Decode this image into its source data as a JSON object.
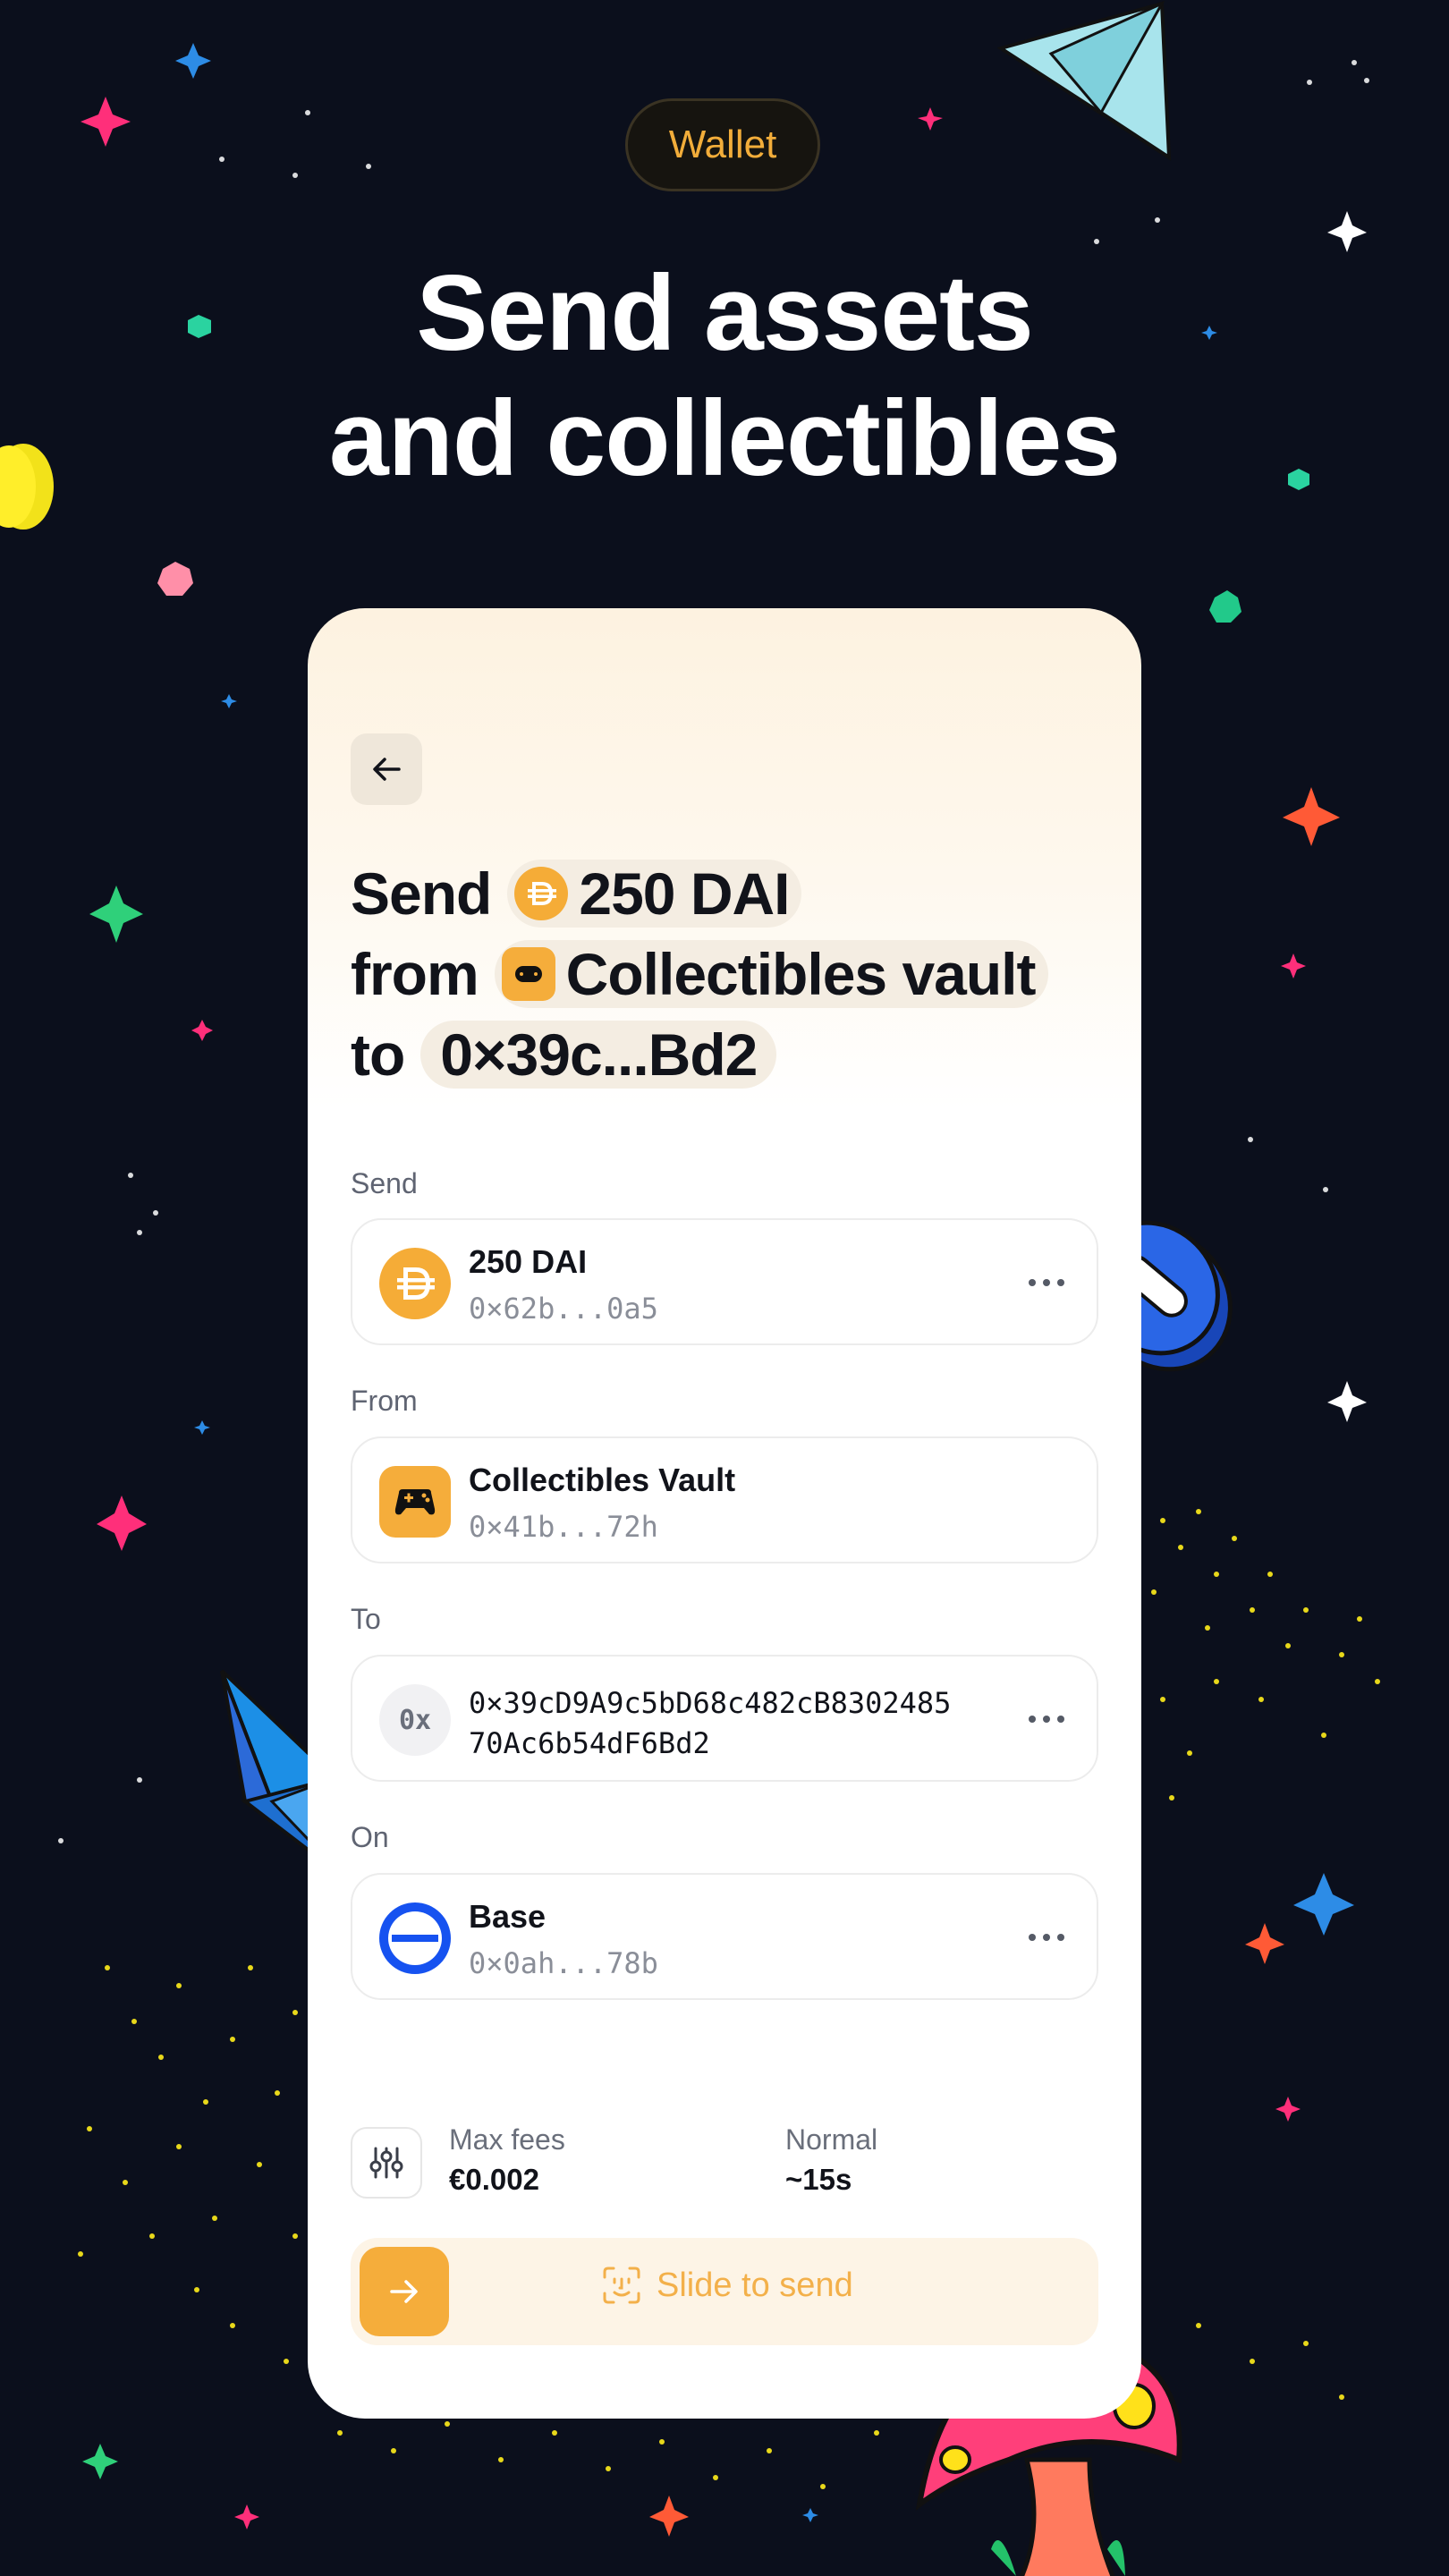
{
  "pill_label": "Wallet",
  "headline": {
    "line1": "Send assets",
    "line2": "and collectibles"
  },
  "summary": {
    "send_word": "Send",
    "amount": "250 DAI",
    "from_word": "from",
    "vault": "Collectibles vault",
    "to_word": "to",
    "address_short": "0×39c...Bd2"
  },
  "sections": {
    "send": {
      "label": "Send",
      "title": "250 DAI",
      "sub": "0×62b...0a5"
    },
    "from": {
      "label": "From",
      "title": "Collectibles Vault",
      "sub": "0×41b...72h"
    },
    "to": {
      "label": "To",
      "avatar_text": "0x",
      "address_line1": "0×39cD9A9c5bD68c482cB8302485",
      "address_line2": "70Ac6b54dF6Bd2"
    },
    "on": {
      "label": "On",
      "title": "Base",
      "sub": "0×0ah...78b"
    }
  },
  "fees": {
    "max_label": "Max fees",
    "max_value": "€0.002",
    "speed_label": "Normal",
    "speed_value": "~15s"
  },
  "slider_label": "Slide to send",
  "colors": {
    "background": "#0b0f1c",
    "accent": "#f5ad3b",
    "base_blue": "#1652f0",
    "text": "#11131a"
  }
}
